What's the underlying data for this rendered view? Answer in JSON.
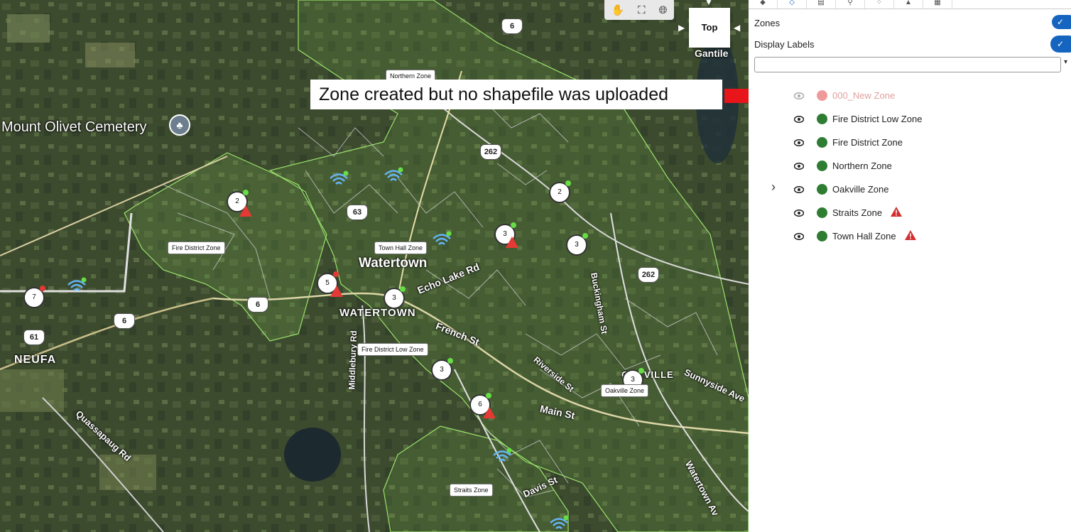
{
  "map": {
    "zone_labels": [
      {
        "name": "Northern Zone"
      },
      {
        "name": "Fire District Zone"
      },
      {
        "name": "Town Hall Zone"
      },
      {
        "name": "Fire District Low Zone"
      },
      {
        "name": "Oakville Zone"
      },
      {
        "name": "Straits Zone"
      }
    ],
    "place_names": {
      "cemetery": "Mount Olivet Cemetery",
      "watertown": "Watertown",
      "watertown_caps": "WATERTOWN",
      "neufa": "NEUFA",
      "quassapaug": "Quassapaug Rd",
      "echo_lake": "Echo Lake Rd",
      "french_st": "French St",
      "main_st": "Main St",
      "riverside": "Riverside St",
      "sunnyside": "Sunnyside Ave",
      "davis": "Davis St",
      "middlebury": "Middlebury Rd",
      "buckingham": "Buckingham St",
      "watertown_ave": "Watertown Av",
      "oakville": "OAKVILLE",
      "gantile": "Gantile"
    },
    "route_shields": [
      "6",
      "262",
      "63",
      "262",
      "6",
      "6",
      "61"
    ],
    "clusters": [
      {
        "count": "2",
        "status": "green"
      },
      {
        "count": "7",
        "status": "red"
      },
      {
        "count": "5",
        "status": "red"
      },
      {
        "count": "3",
        "status": "green"
      },
      {
        "count": "3",
        "status": "green"
      },
      {
        "count": "2",
        "status": "green"
      },
      {
        "count": "3",
        "status": "green"
      },
      {
        "count": "3",
        "status": "green"
      },
      {
        "count": "3",
        "status": "green"
      },
      {
        "count": "6",
        "status": "green"
      }
    ],
    "view_button": "Top",
    "callout_text": "Zone created but no shapefile was uploaded",
    "colors": {
      "zone_fill": "#5a8a3a",
      "zone_border": "#9be36b",
      "sensor": "#64b5f6",
      "alert": "#e53935"
    }
  },
  "panel": {
    "zones_label": "Zones",
    "display_labels_label": "Display Labels",
    "filter_value": "",
    "zones": [
      {
        "name": "000_New Zone",
        "color": "#ef9a9a",
        "disabled": true,
        "warning": false,
        "expandable": false
      },
      {
        "name": "Fire District Low Zone",
        "color": "#2e7d32",
        "disabled": false,
        "warning": false,
        "expandable": false
      },
      {
        "name": "Fire District Zone",
        "color": "#2e7d32",
        "disabled": false,
        "warning": false,
        "expandable": false
      },
      {
        "name": "Northern Zone",
        "color": "#2e7d32",
        "disabled": false,
        "warning": false,
        "expandable": false
      },
      {
        "name": "Oakville Zone",
        "color": "#2e7d32",
        "disabled": false,
        "warning": false,
        "expandable": true
      },
      {
        "name": "Straits Zone",
        "color": "#2e7d32",
        "disabled": false,
        "warning": true,
        "expandable": false
      },
      {
        "name": "Town Hall Zone",
        "color": "#2e7d32",
        "disabled": false,
        "warning": true,
        "expandable": false
      }
    ],
    "colors": {
      "toggle": "#1565c0",
      "warning": "#d32f2f"
    }
  }
}
